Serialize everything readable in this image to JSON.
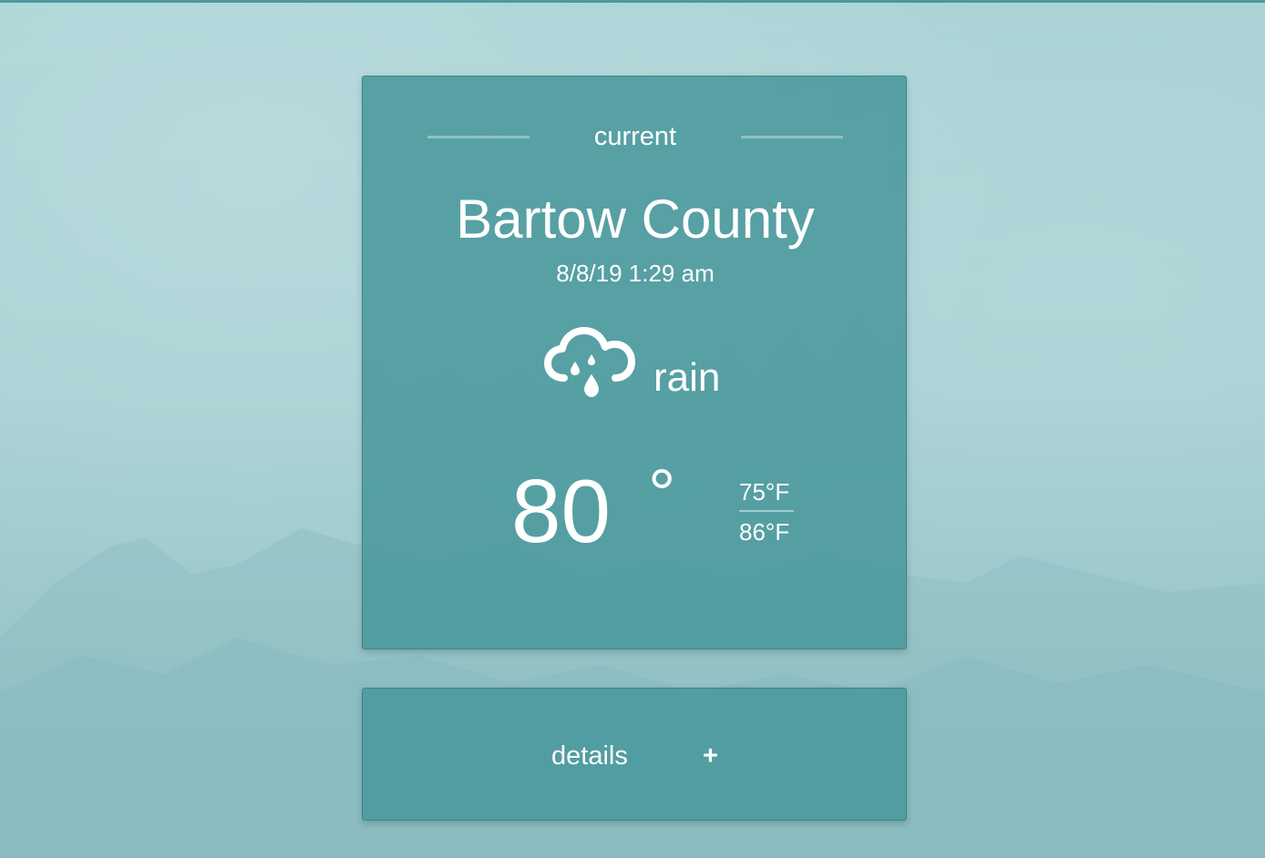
{
  "theme": {
    "card_color": "#4a999c",
    "background_color": "#a6d0d3",
    "text_color": "#ffffff"
  },
  "current": {
    "section_label": "current",
    "location": "Bartow County",
    "datetime": "8/8/19 1:29 am",
    "condition_icon": "cloud-rain-icon",
    "condition": "rain",
    "temperature": "80",
    "degree_symbol": "°",
    "low": "75°F",
    "high": "86°F"
  },
  "details": {
    "label": "details",
    "expand_symbol": "+"
  }
}
